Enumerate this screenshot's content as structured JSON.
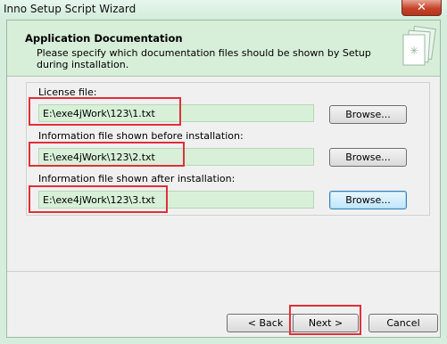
{
  "window": {
    "title": "Inno Setup Script Wizard",
    "close_glyph": "✕"
  },
  "header": {
    "title": "Application Documentation",
    "subtitle": "Please specify which documentation files should be shown by Setup during installation."
  },
  "fields": [
    {
      "label": "License file:",
      "value": "E:\\exe4jWork\\123\\1.txt",
      "browse": "Browse..."
    },
    {
      "label": "Information file shown before installation:",
      "value": "E:\\exe4jWork\\123\\2.txt",
      "browse": "Browse..."
    },
    {
      "label": "Information file shown after installation:",
      "value": "E:\\exe4jWork\\123\\3.txt",
      "browse": "Browse..."
    }
  ],
  "footer": {
    "back": "< Back",
    "next": "Next >",
    "cancel": "Cancel"
  },
  "colors": {
    "highlight": "#e0303a",
    "accent": "#d7eed8"
  }
}
